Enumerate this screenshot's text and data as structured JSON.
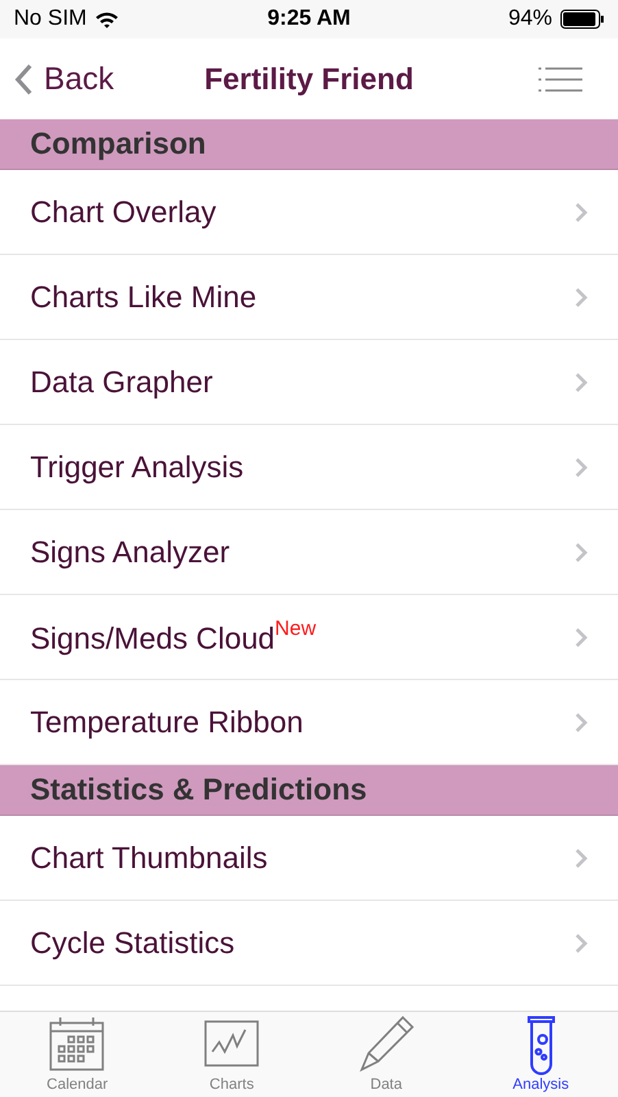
{
  "status_bar": {
    "carrier": "No SIM",
    "time": "9:25 AM",
    "battery": "94%"
  },
  "nav": {
    "back": "Back",
    "title": "Fertility Friend"
  },
  "sections": [
    {
      "title": "Comparison",
      "items": [
        {
          "label": "Chart Overlay"
        },
        {
          "label": "Charts Like Mine"
        },
        {
          "label": "Data Grapher"
        },
        {
          "label": "Trigger Analysis"
        },
        {
          "label": "Signs Analyzer"
        },
        {
          "label": "Signs/Meds Cloud",
          "badge": "New"
        },
        {
          "label": "Temperature Ribbon"
        }
      ]
    },
    {
      "title": "Statistics & Predictions",
      "items": [
        {
          "label": "Chart Thumbnails"
        },
        {
          "label": "Cycle Statistics"
        }
      ]
    }
  ],
  "tabs": [
    {
      "label": "Calendar",
      "kind": "calendar",
      "selected": false
    },
    {
      "label": "Charts",
      "kind": "chart",
      "selected": false
    },
    {
      "label": "Data",
      "kind": "pencil",
      "selected": false
    },
    {
      "label": "Analysis",
      "kind": "tube",
      "selected": true
    }
  ]
}
